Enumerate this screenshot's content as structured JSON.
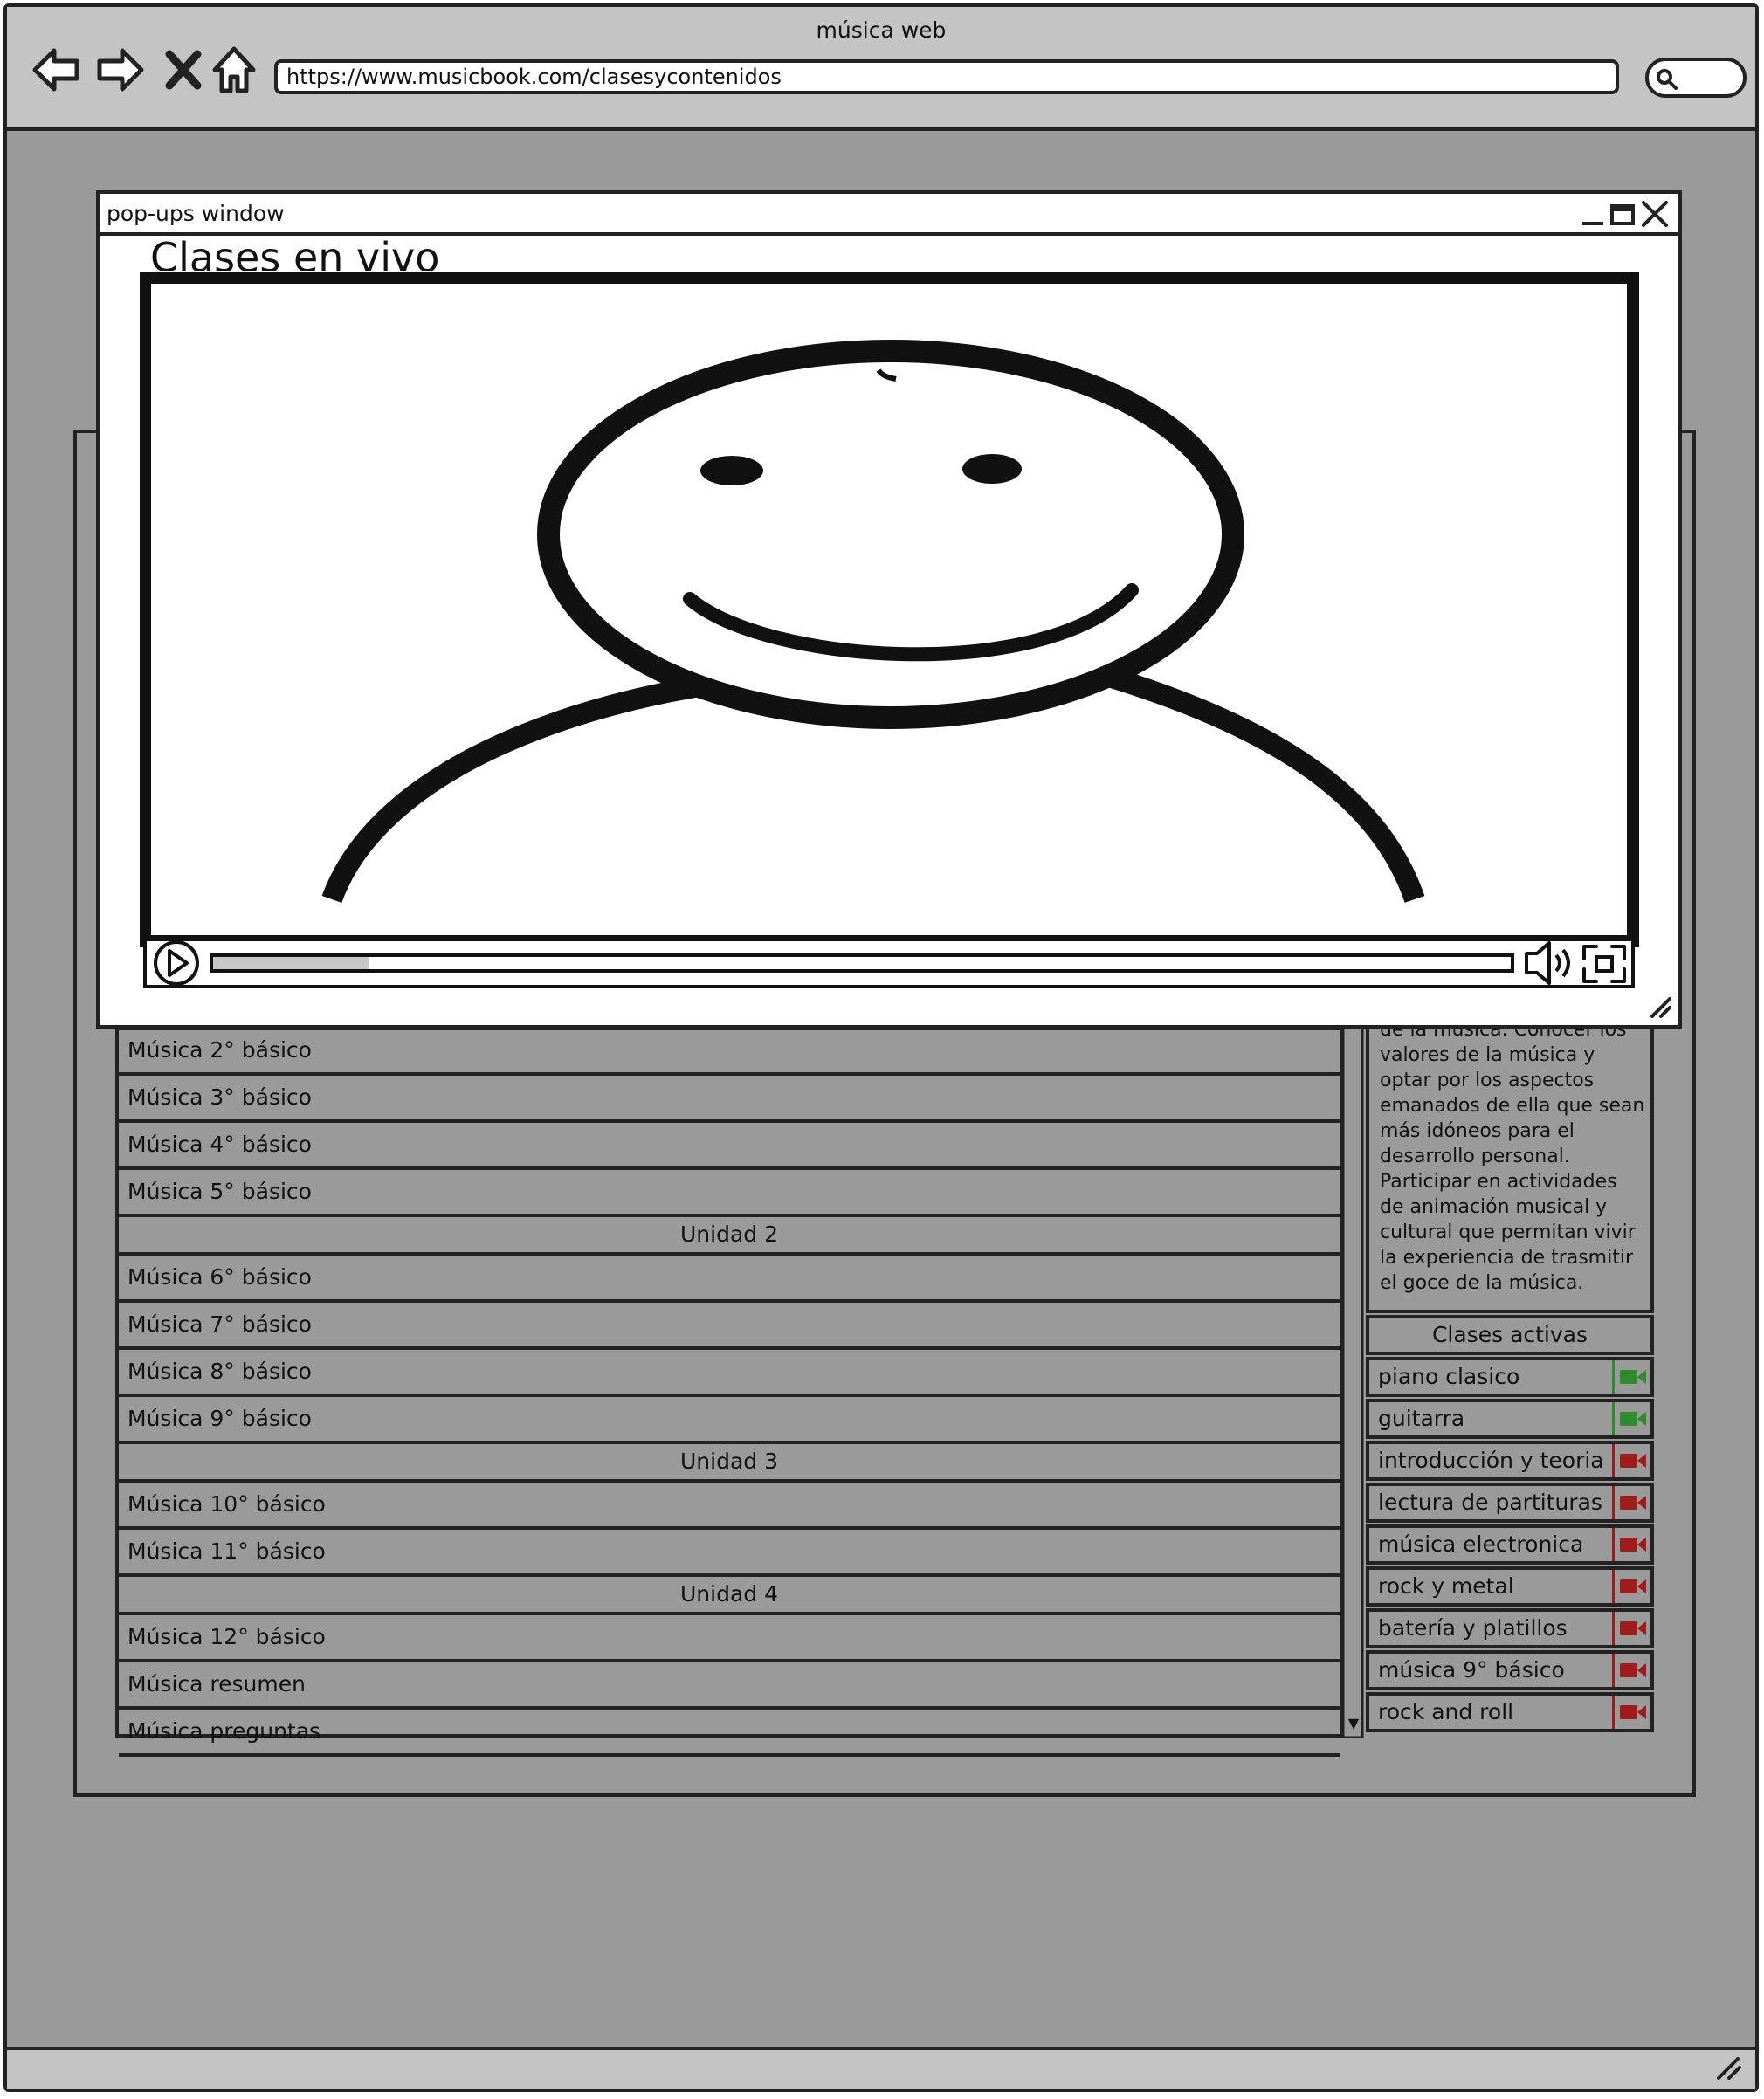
{
  "window": {
    "title": "música web"
  },
  "address_bar": {
    "url": "https://www.musicbook.com/clasesycontenidos"
  },
  "units": [
    {
      "label": "Música 2° básico",
      "kind": "item"
    },
    {
      "label": "Música 3° básico",
      "kind": "item"
    },
    {
      "label": "Música 4° básico",
      "kind": "item"
    },
    {
      "label": "Música 5° básico",
      "kind": "item"
    },
    {
      "label": "Unidad 2",
      "kind": "unit"
    },
    {
      "label": "Música 6° básico",
      "kind": "item"
    },
    {
      "label": "Música 7° básico",
      "kind": "item"
    },
    {
      "label": "Música 8° básico",
      "kind": "item"
    },
    {
      "label": "Música 9° básico",
      "kind": "item"
    },
    {
      "label": "Unidad 3",
      "kind": "unit"
    },
    {
      "label": "Música 10° básico",
      "kind": "item"
    },
    {
      "label": "Música 11° básico",
      "kind": "item"
    },
    {
      "label": "Unidad 4",
      "kind": "unit"
    },
    {
      "label": "Música 12° básico",
      "kind": "item"
    },
    {
      "label": "Música resumen",
      "kind": "item"
    },
    {
      "label": "Música preguntas",
      "kind": "item"
    }
  ],
  "description": {
    "text": "de la música. Conocer los valores de la música y optar por los aspectos emanados de ella que sean más idóneos para el desarrollo personal. Participar en actividades de animación musical y cultural que permitan vivir la experiencia de trasmitir el goce de la música."
  },
  "active_classes": {
    "header": "Clases activas",
    "items": [
      {
        "label": "piano clasico",
        "live": true
      },
      {
        "label": "guitarra",
        "live": true
      },
      {
        "label": "introducción y teoria",
        "live": false
      },
      {
        "label": "lectura de partituras",
        "live": false
      },
      {
        "label": "música electronica",
        "live": false
      },
      {
        "label": "rock y metal",
        "live": false
      },
      {
        "label": "batería y platillos",
        "live": false
      },
      {
        "label": "música 9° básico",
        "live": false
      },
      {
        "label": "rock and roll",
        "live": false
      }
    ]
  },
  "popup": {
    "title": "pop-ups window",
    "heading": "Clases en vivo",
    "video": {
      "progress": 0.12
    }
  },
  "colors": {
    "live": "#2e8b2e",
    "offline": "#a01c1c",
    "page_bg": "#9a9a9a",
    "chrome_bg": "#c4c4c4"
  }
}
